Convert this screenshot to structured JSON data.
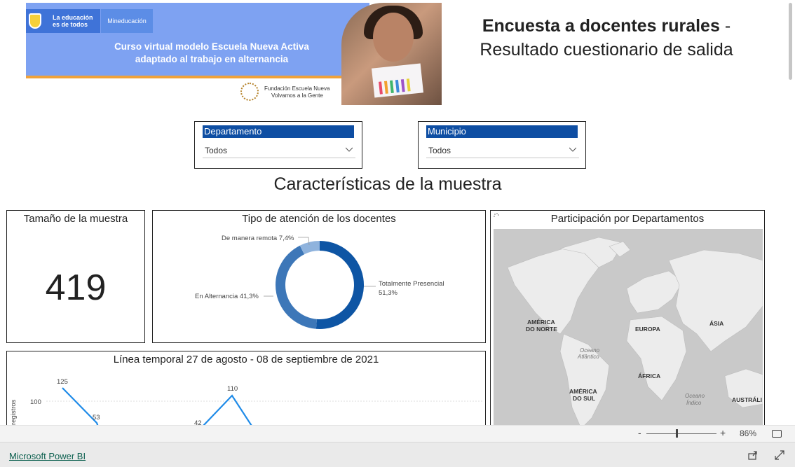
{
  "banner": {
    "gov_line1": "La educación",
    "gov_line2": "es de todos",
    "ministry": "Mineducación",
    "course_line1": "Curso virtual modelo Escuela Nueva Activa",
    "course_line2": "adaptado al trabajo en alternancia",
    "foundation_line1": "Fundación Escuela Nueva",
    "foundation_line2": "Volvamos a la Gente"
  },
  "header": {
    "title_bold": "Encuesta a docentes rurales",
    "title_dash": " -",
    "subtitle": "Resultado cuestionario de salida"
  },
  "filters": {
    "departamento": {
      "label": "Departamento",
      "value": "Todos"
    },
    "municipio": {
      "label": "Municipio",
      "value": "Todos"
    }
  },
  "section_title": "Características de la muestra",
  "sample_size": {
    "title": "Tamaño de la muestra",
    "value": "419"
  },
  "donut": {
    "title": "Tipo de atención de los docentes",
    "colors": [
      "#0e55a4",
      "#3d77b8",
      "#8fb3dd"
    ],
    "chart_data": {
      "type": "pie",
      "slices": [
        {
          "label": "Totalmente Presencial",
          "value": 51.3,
          "text": "51,3%"
        },
        {
          "label": "En Alternancia",
          "value": 41.3,
          "text": "41,3%"
        },
        {
          "label": "De manera remota",
          "value": 7.4,
          "text": "7,4%"
        }
      ]
    }
  },
  "map": {
    "title": "Participación por Departamentos",
    "labels": {
      "north_america": "AMÉRICA",
      "north_america_2": "DO NORTE",
      "south_america": "AMÉRICA",
      "south_america_2": "DO SUL",
      "europe": "EUROPA",
      "asia": "ÁSIA",
      "africa": "ÁFRICA",
      "australia": "AUSTRÁLI",
      "atlantic": "Oceano",
      "atlantic_2": "Atlântico",
      "indian": "Oceano",
      "indian_2": "Índico"
    }
  },
  "timeline": {
    "title": "Línea temporal 27 de agosto - 08 de septiembre de 2021",
    "ylabel": "registros",
    "ytick": "100",
    "point_labels": [
      "125",
      "53",
      "42",
      "110"
    ],
    "line_color": "#1f8be8"
  },
  "zoom": {
    "minus": "-",
    "plus": "+",
    "percent": "86%"
  },
  "footer": {
    "brand": "Microsoft Power BI"
  }
}
